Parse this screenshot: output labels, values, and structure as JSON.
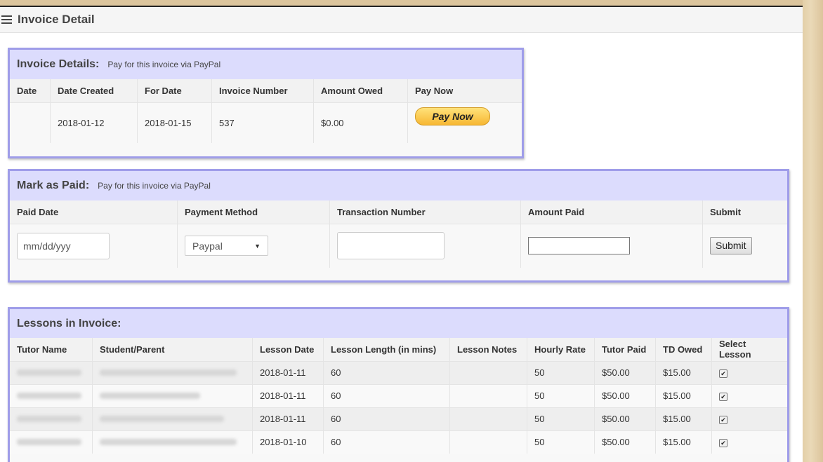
{
  "page": {
    "title": "Invoice Detail"
  },
  "invoice_details": {
    "title": "Invoice Details:",
    "subtitle": "Pay for this invoice via PayPal",
    "headers": [
      "Date",
      "Date Created",
      "For Date",
      "Invoice Number",
      "Amount Owed",
      "Pay Now"
    ],
    "row": {
      "date": "",
      "date_created": "2018-01-12",
      "for_date": "2018-01-15",
      "invoice_number": "537",
      "amount_owed": "$0.00",
      "pay_now_label": "Pay Now"
    }
  },
  "mark_paid": {
    "title": "Mark as Paid:",
    "subtitle": "Pay for this invoice via PayPal",
    "headers": [
      "Paid Date",
      "Payment Method",
      "Transaction Number",
      "Amount Paid",
      "Submit"
    ],
    "date_placeholder": "mm/dd/yyy",
    "payment_method": "Paypal",
    "transaction_number": "",
    "amount_paid": "",
    "submit_label": "Submit"
  },
  "lessons": {
    "title": "Lessons in Invoice:",
    "headers": [
      "Tutor Name",
      "Student/Parent",
      "Lesson Date",
      "Lesson Length (in mins)",
      "Lesson Notes",
      "Hourly Rate",
      "Tutor Paid",
      "TD Owed",
      "Select Lesson"
    ],
    "rows": [
      {
        "lesson_date": "2018-01-11",
        "length": "60",
        "notes": "",
        "rate": "50",
        "tutor_paid": "$50.00",
        "td_owed": "$15.00",
        "selected": true
      },
      {
        "lesson_date": "2018-01-11",
        "length": "60",
        "notes": "",
        "rate": "50",
        "tutor_paid": "$50.00",
        "td_owed": "$15.00",
        "selected": true
      },
      {
        "lesson_date": "2018-01-11",
        "length": "60",
        "notes": "",
        "rate": "50",
        "tutor_paid": "$50.00",
        "td_owed": "$15.00",
        "selected": true
      },
      {
        "lesson_date": "2018-01-10",
        "length": "60",
        "notes": "",
        "rate": "50",
        "tutor_paid": "$50.00",
        "td_owed": "$15.00",
        "selected": true
      }
    ]
  }
}
